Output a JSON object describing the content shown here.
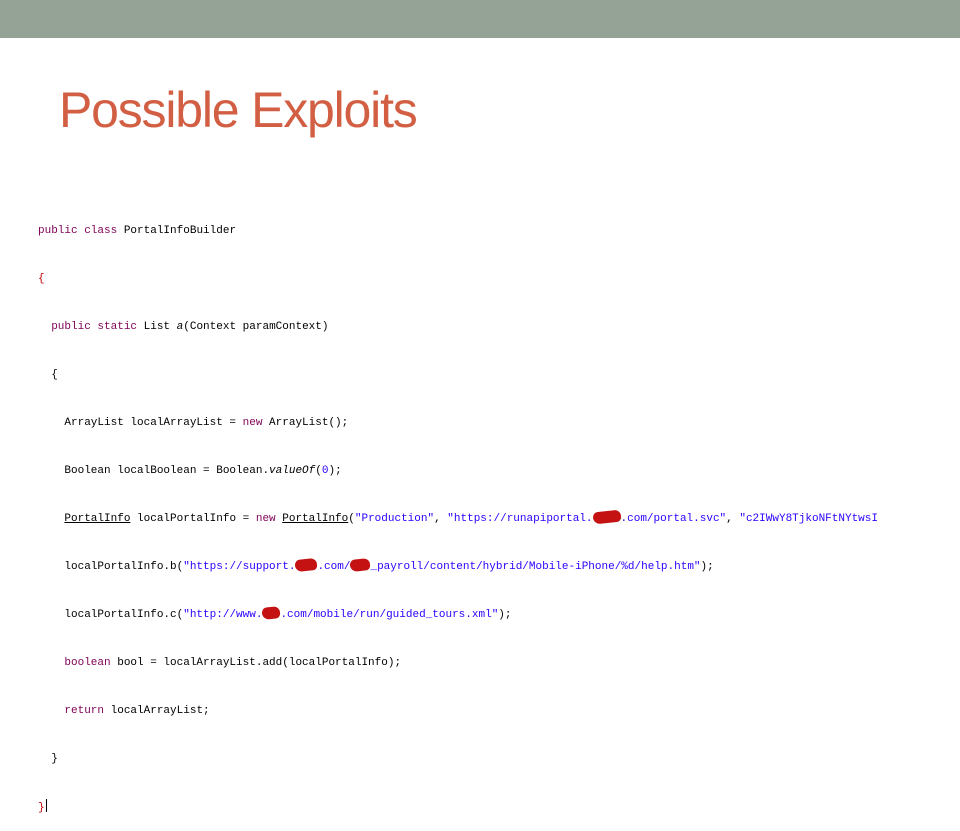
{
  "slide": {
    "title": "Possible Exploits"
  },
  "code": {
    "line1": {
      "kw": "public class ",
      "rest": "PortalInfoBuilder"
    },
    "line2": {
      "brace": "{"
    },
    "line3": {
      "indent": "  ",
      "kw": "public static ",
      "a": "List ",
      "method": "a",
      "rest": "(Context paramContext)"
    },
    "line4": {
      "indent": "  ",
      "brace": "{"
    },
    "line5": {
      "indent": "    ",
      "a": "ArrayList localArrayList = ",
      "kw": "new ",
      "rest": "ArrayList();"
    },
    "line6": {
      "indent": "    ",
      "a": "Boolean localBoolean = Boolean.",
      "method": "valueOf",
      "b": "(",
      "num": "0",
      "rest": ");"
    },
    "line7": {
      "indent": "    ",
      "type1": "PortalInfo",
      "a": " localPortalInfo = ",
      "kw": "new ",
      "type2": "PortalInfo",
      "b": "(",
      "s1": "\"Production\"",
      "c": ", ",
      "s2a": "\"https://runapiportal.",
      "s2b": ".com/portal.svc\"",
      "d": ", ",
      "s3": "\"c2IWwY8TjkoNFtNYtwsI"
    },
    "line8": {
      "indent": "    ",
      "a": "localPortalInfo.b(",
      "s1": "\"https://support.",
      "s2": ".com/",
      "s3": "_payroll/content/hybrid/Mobile-iPhone/%d/help.htm\"",
      "rest": ");"
    },
    "line9": {
      "indent": "    ",
      "a": "localPortalInfo.c(",
      "s1": "\"http://www.",
      "s2": ".com/mobile/run/guided_tours.xml\"",
      "rest": ");"
    },
    "line10": {
      "indent": "    ",
      "kw": "boolean ",
      "rest": "bool = localArrayList.add(localPortalInfo);"
    },
    "line11": {
      "indent": "    ",
      "kw": "return ",
      "rest": "localArrayList;"
    },
    "line12": {
      "indent": "  ",
      "brace": "}"
    },
    "line13": {
      "brace": "}"
    }
  }
}
